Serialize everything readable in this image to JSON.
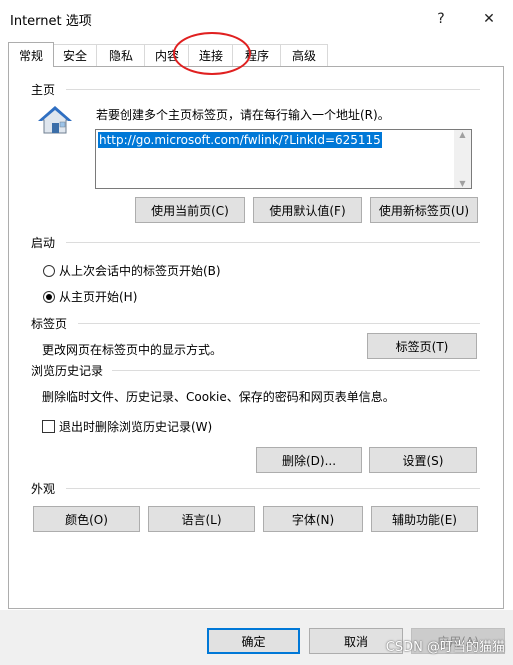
{
  "window": {
    "title": "Internet 选项",
    "help": "?",
    "close": "✕"
  },
  "tabs": [
    "常规",
    "安全",
    "隐私",
    "内容",
    "连接",
    "程序",
    "高级"
  ],
  "homepage": {
    "group": "主页",
    "desc": "若要创建多个主页标签页，请在每行输入一个地址(R)。",
    "url": "http://go.microsoft.com/fwlink/?LinkId=625115",
    "buttons": [
      "使用当前页(C)",
      "使用默认值(F)",
      "使用新标签页(U)"
    ]
  },
  "startup": {
    "group": "启动",
    "options": [
      "从上次会话中的标签页开始(B)",
      "从主页开始(H)"
    ],
    "selected_index": 1
  },
  "tabs_section": {
    "group": "标签页",
    "desc": "更改网页在标签页中的显示方式。",
    "button": "标签页(T)"
  },
  "history": {
    "group": "浏览历史记录",
    "desc": "删除临时文件、历史记录、Cookie、保存的密码和网页表单信息。",
    "checkbox": "退出时删除浏览历史记录(W)",
    "checked": false,
    "buttons": [
      "删除(D)...",
      "设置(S)"
    ]
  },
  "appearance": {
    "group": "外观",
    "buttons": [
      "颜色(O)",
      "语言(L)",
      "字体(N)",
      "辅助功能(E)"
    ]
  },
  "footer": {
    "ok": "确定",
    "cancel": "取消",
    "apply": "应用(A)"
  },
  "watermark": "CSDN @叮当的猫猫",
  "colors": {
    "accent": "#0078d7",
    "highlight_circle": "#e02020",
    "button_face": "#e1e1e1"
  }
}
